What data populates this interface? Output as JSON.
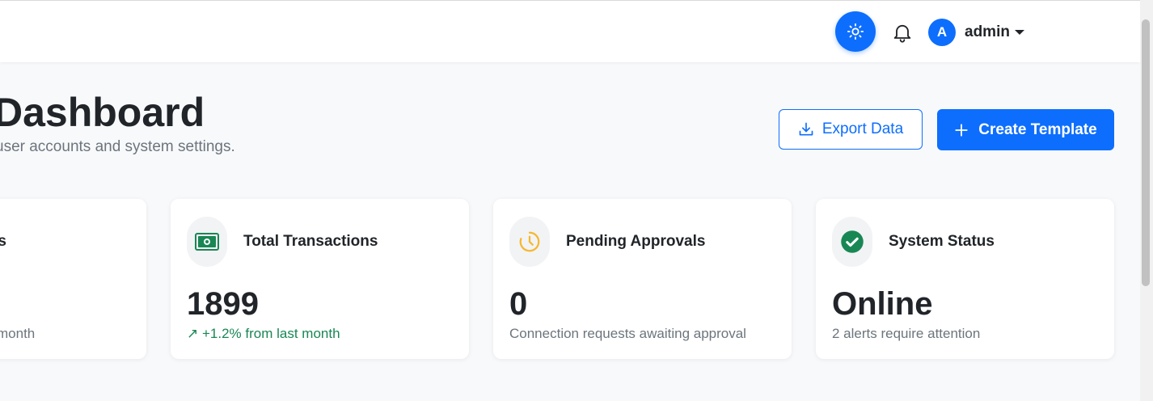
{
  "navbar": {
    "theme_icon": "sun-icon",
    "bell_icon": "bell-icon",
    "user": {
      "avatar_letter": "A",
      "name": "admin"
    }
  },
  "header": {
    "title": "Dashboard",
    "subtitle": "user accounts and system settings."
  },
  "actions": {
    "export_label": "Export Data",
    "create_label": "Create Template"
  },
  "cards": [
    {
      "title": "rs",
      "value": "",
      "note": "month"
    },
    {
      "title": "Total Transactions",
      "value": "1899",
      "note": "+1.2% from last month",
      "icon": "cash-icon"
    },
    {
      "title": "Pending Approvals",
      "value": "0",
      "note": "Connection requests awaiting approval",
      "icon": "clock-icon"
    },
    {
      "title": "System Status",
      "value": "Online",
      "note": "2 alerts require attention",
      "icon": "check-circle-icon"
    }
  ],
  "colors": {
    "primary": "#0d6efd",
    "success": "#198754",
    "warning": "#f5b82e",
    "muted": "#6c757d"
  }
}
